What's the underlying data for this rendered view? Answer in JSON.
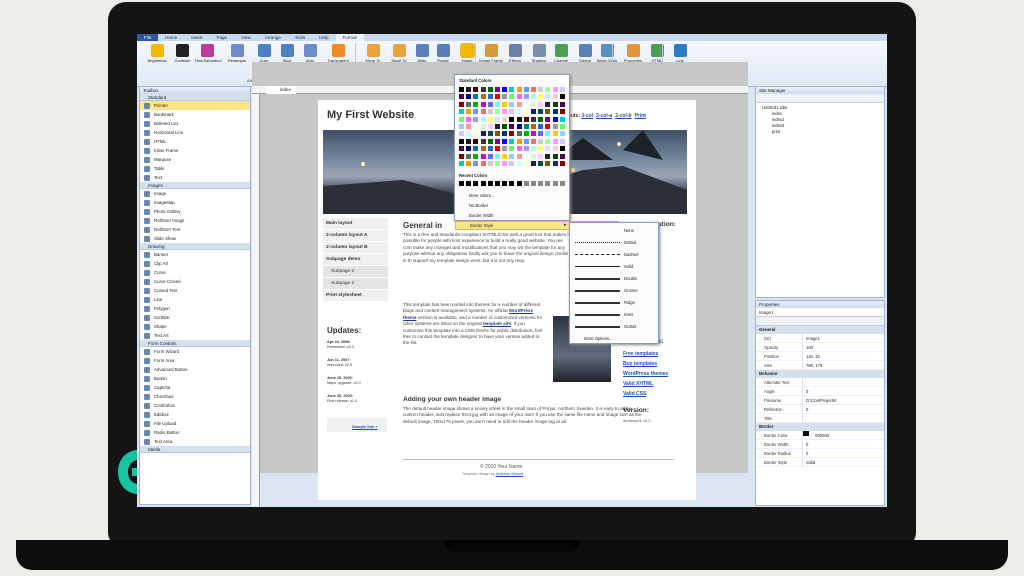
{
  "ribbon": {
    "tabs": [
      "File",
      "Home",
      "Insert",
      "Page",
      "View",
      "Arrange",
      "Tools",
      "Help",
      "Format"
    ],
    "buttons": [
      "Brightness",
      "Contrast",
      "Hue/Saturation",
      "Resample",
      "Crop",
      "Slice",
      "Auto Thumbnail",
      "Transparent Color",
      "Move To Front",
      "Move To Back",
      "Align",
      "Rotate",
      "Image Border",
      "Image Frame",
      "Effects",
      "Shadow",
      "Change Shape",
      "Stencil",
      "Water Mark",
      "Properties",
      "HTML",
      "Link"
    ],
    "groups": [
      "Adjust",
      "Arrange",
      "Image Styles",
      "Properties",
      "Link"
    ]
  },
  "toolbox": {
    "title": "Toolbox",
    "sections": [
      {
        "name": "Standard",
        "items": [
          "Pointer",
          "Bookmark",
          "Bulleted List",
          "Horizontal Line",
          "HTML",
          "Inline Frame",
          "Marquee",
          "Table",
          "Text"
        ]
      },
      {
        "name": "Images",
        "items": [
          "Image",
          "ImageMap",
          "Photo Gallery",
          "RollOver Image",
          "RollOver Text",
          "Slide Show"
        ]
      },
      {
        "name": "Drawing",
        "items": [
          "Banner",
          "Clip Art",
          "Curve",
          "Curve Closed",
          "Curved Text",
          "Line",
          "Polygon",
          "Scribble",
          "Shape",
          "Text Art"
        ]
      },
      {
        "name": "Form Controls",
        "items": [
          "Form Wizard",
          "Form Area",
          "Advanced Button",
          "Button",
          "Captcha",
          "Checkbox",
          "Combobox",
          "Editbox",
          "File Upload",
          "Radio Button",
          "Text Area"
        ]
      },
      {
        "name": "Media",
        "items": []
      }
    ]
  },
  "doc": {
    "tab": "index",
    "title": "My First Website",
    "layouts": "youts:",
    "layout_links": [
      "3-col",
      "2-col-a",
      "2-col-b",
      "Print"
    ],
    "nav": [
      "Main layout",
      "2-column layout A",
      "2-column layout B",
      "Subpage demo",
      "Subpage 2",
      "Subpage 2",
      "Print stylesheet"
    ],
    "updates_title": "Updates:",
    "updates": [
      [
        "Apr 24, 2008:",
        "Refreshed: v3.0"
      ],
      [
        "Jun 11, 2007:",
        "Improved: v2.0"
      ],
      [
        "June 25, 2006:",
        "Major upgrade: v2.0"
      ],
      [
        "June 25, 2005:",
        "First release: v1.0"
      ]
    ],
    "sample_link": "Sample link »",
    "general_title": "General in",
    "general_text": "This is a free and standards-compliant XHTML/CSS web a great tool that makes it possible for people with limit experience to build a really good website. You are com make any changes and modifications that you may wa the template for any purpose without any obligations kindly ask you to leave the original design credits in th support my template design work, but it is not any requ",
    "ported_text1": "This template has been ported into themes for a number of different blogs and content management systems. An official",
    "wp_link": "WordPress theme",
    "ported_text2": "version is available, and a number of customized versions for other systems are listed on the original",
    "template_link": "template site",
    "ported_text3": ". If you customize this template into a CMS theme for public distribution, feel free to contact the template designer to have your version added to the list.",
    "adding_title": "Adding your own header image",
    "adding_text": "The default header image shows a snowy street in the small town of Porjus, northern Sweden. It is easy to add a custom header. Just replace front.jpg with an image of your own! If you use the same file name and image size as the default image, 760x175 pixels, you don't need to edit the header image tag at all.",
    "side_title": "ation:",
    "links_title": "nks:",
    "links": [
      "Free templates",
      "Buy templates",
      "WordPress themes",
      "Valid XHTML",
      "Valid CSS"
    ],
    "version_title": "Version:",
    "version": "andreas01 v3.0",
    "footer": "© 2010 Your Name",
    "footer2": "Template design by",
    "footer_link": "Andreas Viklund"
  },
  "color_menu": {
    "title": "Standard Colors",
    "recent": "Recent Colors",
    "more": "More colors...",
    "no_border": "No Border",
    "width": "Border Width",
    "style": "Border Style"
  },
  "border_styles": [
    "None",
    "Dotted",
    "Dashed",
    "Solid",
    "Double",
    "Groove",
    "Ridge",
    "Inset",
    "Outset",
    "More Options..."
  ],
  "site_manager": {
    "title": "Site Manager",
    "root": "Untitled1.wbs",
    "pages": [
      "index",
      "index2",
      "index3",
      "print"
    ]
  },
  "properties": {
    "title": "Properties",
    "object": "Image1",
    "sections": [
      {
        "name": "General",
        "rows": [
          [
            "(ID)",
            "Image1"
          ],
          [
            "Opacity",
            "100"
          ],
          [
            "Position",
            "118, 15"
          ],
          [
            "Size",
            "760, 175"
          ]
        ]
      },
      {
        "name": "Behavior",
        "rows": [
          [
            "Alternate Text",
            ""
          ],
          [
            "Angle",
            "0"
          ],
          [
            "Filename",
            "D:\\CoolProjects\\"
          ],
          [
            "Reflection",
            "0"
          ],
          [
            "Title",
            ""
          ]
        ]
      },
      {
        "name": "Border",
        "rows": [
          [
            "Border Color",
            "000000"
          ],
          [
            "Border Width",
            "0"
          ],
          [
            "Border Radius",
            "0"
          ],
          [
            "Border Style",
            "Solid"
          ]
        ]
      }
    ]
  }
}
